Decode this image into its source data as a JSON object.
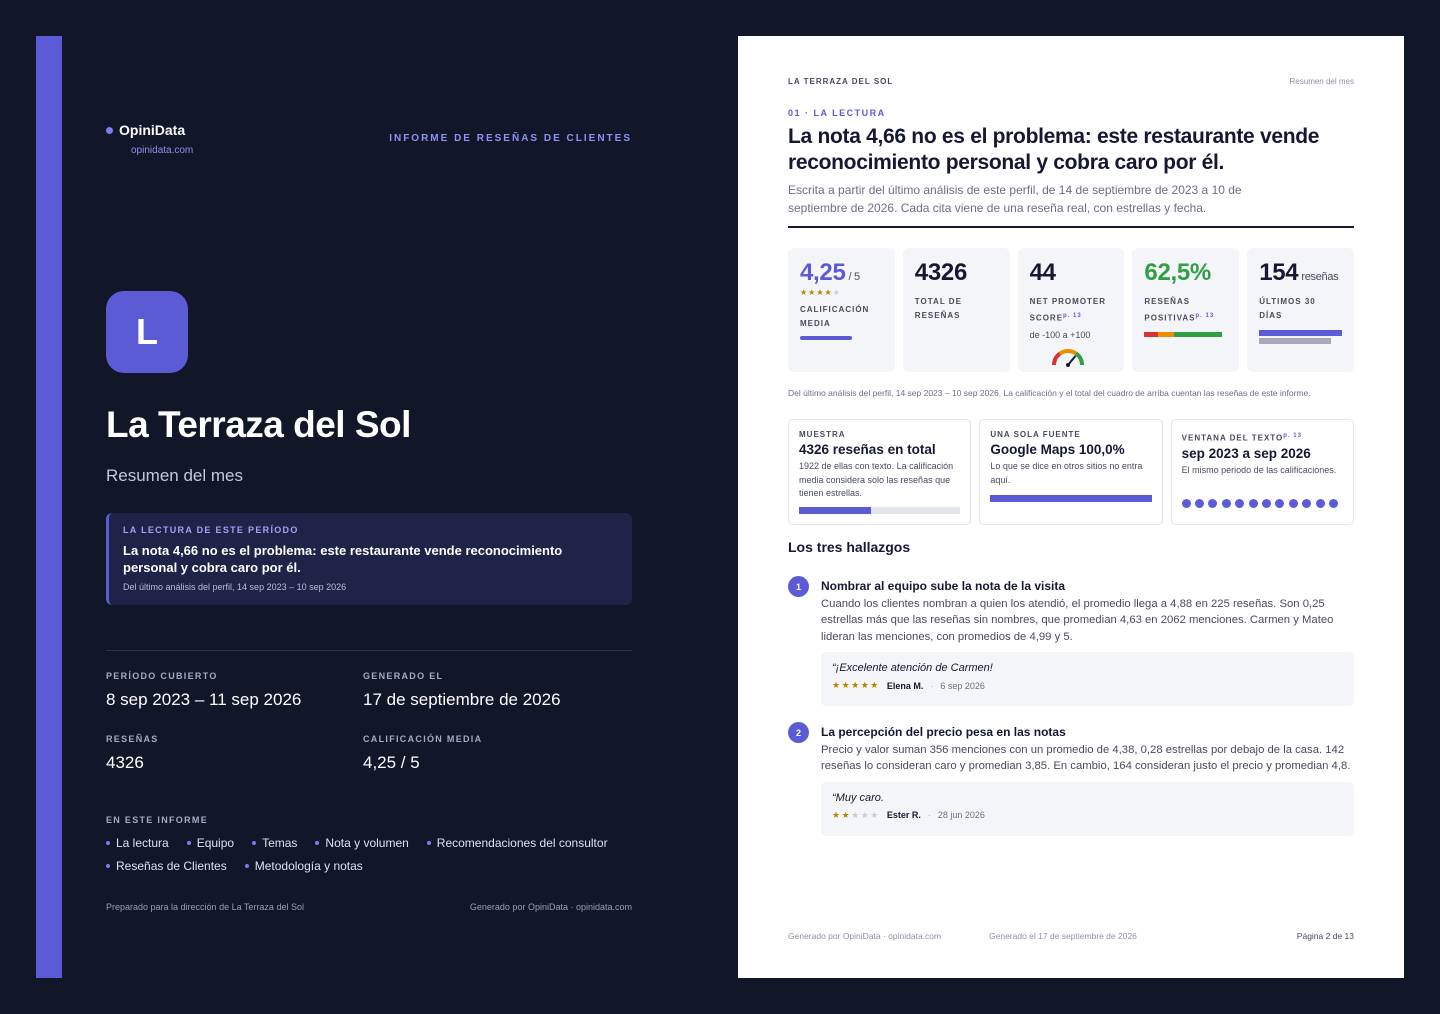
{
  "cover": {
    "brand": "OpiniData",
    "brand_url": "opinidata.com",
    "report_kind": "INFORME DE RESEÑAS DE CLIENTES",
    "logo_letter": "L",
    "title": "La Terraza del Sol",
    "subtitle": "Resumen del mes",
    "reading": {
      "label": "LA LECTURA DE ESTE PERÍODO",
      "text": "La nota 4,66 no es el problema: este restaurante vende reconocimiento personal y cobra caro por él.",
      "footnote": "Del último análisis del perfil, 14 sep 2023 – 10 sep 2026"
    },
    "meta": [
      {
        "label": "PERÍODO CUBIERTO",
        "value": "8 sep 2023 – 11 sep 2026"
      },
      {
        "label": "GENERADO EL",
        "value": "17 de septiembre de 2026"
      },
      {
        "label": "RESEÑAS",
        "value": "4326"
      },
      {
        "label": "CALIFICACIÓN MEDIA",
        "value": "4,25 / 5"
      }
    ],
    "toc_label": "EN ESTE INFORME",
    "toc": [
      "La lectura",
      "Equipo",
      "Temas",
      "Nota y volumen",
      "Recomendaciones del consultor",
      "Reseñas de Clientes",
      "Metodología y notas"
    ],
    "footer_left": "Preparado para la dirección de La Terraza del Sol",
    "footer_right": "Generado por OpiniData · opinidata.com"
  },
  "page": {
    "running_left": "LA TERRAZA DEL SOL",
    "running_right": "Resumen del mes",
    "section_label": "01 · LA LECTURA",
    "title": "La nota 4,66 no es el problema: este restaurante vende reconocimiento personal y cobra caro por él.",
    "lede": "Escrita a partir del último análisis de este perfil, de 14 de septiembre de 2023 a 10 de septiembre de 2026. Cada cita viene de una reseña real, con estrellas y fecha.",
    "kpis": {
      "rating": {
        "value": "4,25",
        "unit": "/ 5",
        "stars": 4.25,
        "label": "CALIFICACIÓN MEDIA",
        "fill": 0.85
      },
      "total": {
        "value": "4326",
        "label": "TOTAL DE RESEÑAS"
      },
      "nps": {
        "value": "44",
        "label": "NET PROMOTER SCORE",
        "ref": "p. 13",
        "range": "de -100 a +100",
        "score": 44
      },
      "positive": {
        "value": "62,5%",
        "label": "RESEÑAS POSITIVAS",
        "ref": "p. 13",
        "share": 0.625
      },
      "recent": {
        "value": "154",
        "unit": "reseñas",
        "label": "ÚLTIMOS 30 DÍAS",
        "bar_current": 1.0,
        "bar_previous": 0.87
      }
    },
    "kpi_colors": {
      "accent": "#5b5bd6",
      "negative": "#d63333",
      "neutral": "#f08c00",
      "positive": "#2ea043",
      "previous": "#a6aab8"
    },
    "note": "Del último análisis del perfil, 14 sep 2023 – 10 sep 2026. La calificación y el total del cuadro de arriba cuentan las reseñas de este informe.",
    "cards": [
      {
        "label": "MUESTRA",
        "value": "4326 reseñas en total",
        "text": "1922 de ellas con texto. La calificación media considera solo las reseñas que tienen estrellas.",
        "fill": 0.444
      },
      {
        "label": "UNA SOLA FUENTE",
        "value": "Google Maps 100,0%",
        "text": "Lo que se dice en otros sitios no entra aquí.",
        "fill": 1.0
      },
      {
        "label": "VENTANA DEL TEXTO",
        "ref": "p. 13",
        "value": "sep 2023 a sep 2026",
        "text": "El mismo periodo de las calificaciones.",
        "dots": 12
      }
    ],
    "findings_title": "Los tres hallazgos",
    "findings": [
      {
        "num": "1",
        "title": "Nombrar al equipo sube la nota de la visita",
        "text": "Cuando los clientes nombran a quien los atendió, el promedio llega a 4,88 en 225 reseñas. Son 0,25 estrellas más que las reseñas sin nombres, que promedian 4,63 en 2062 menciones. Carmen y Mateo lideran las menciones, con promedios de 4,99 y 5.",
        "quote": "“¡Excelente atención de Carmen!",
        "stars": 5,
        "author": "Elena M.",
        "sep": "·",
        "date": "6 sep 2026"
      },
      {
        "num": "2",
        "title": "La percepción del precio pesa en las notas",
        "text": "Precio y valor suman 356 menciones con un promedio de 4,38, 0,28 estrellas por debajo de la casa. 142 reseñas lo consideran caro y promedian 3,85. En cambio, 164 consideran justo el precio y promedian 4,8.",
        "quote": "“Muy caro.",
        "stars": 2,
        "author": "Ester R.",
        "sep": "·",
        "date": "28 jun 2026"
      }
    ],
    "footer_left": "Generado por OpiniData · opinidata.com",
    "footer_mid": "Generado el 17 de septiembre de 2026",
    "footer_right": "Página 2 de 13"
  }
}
